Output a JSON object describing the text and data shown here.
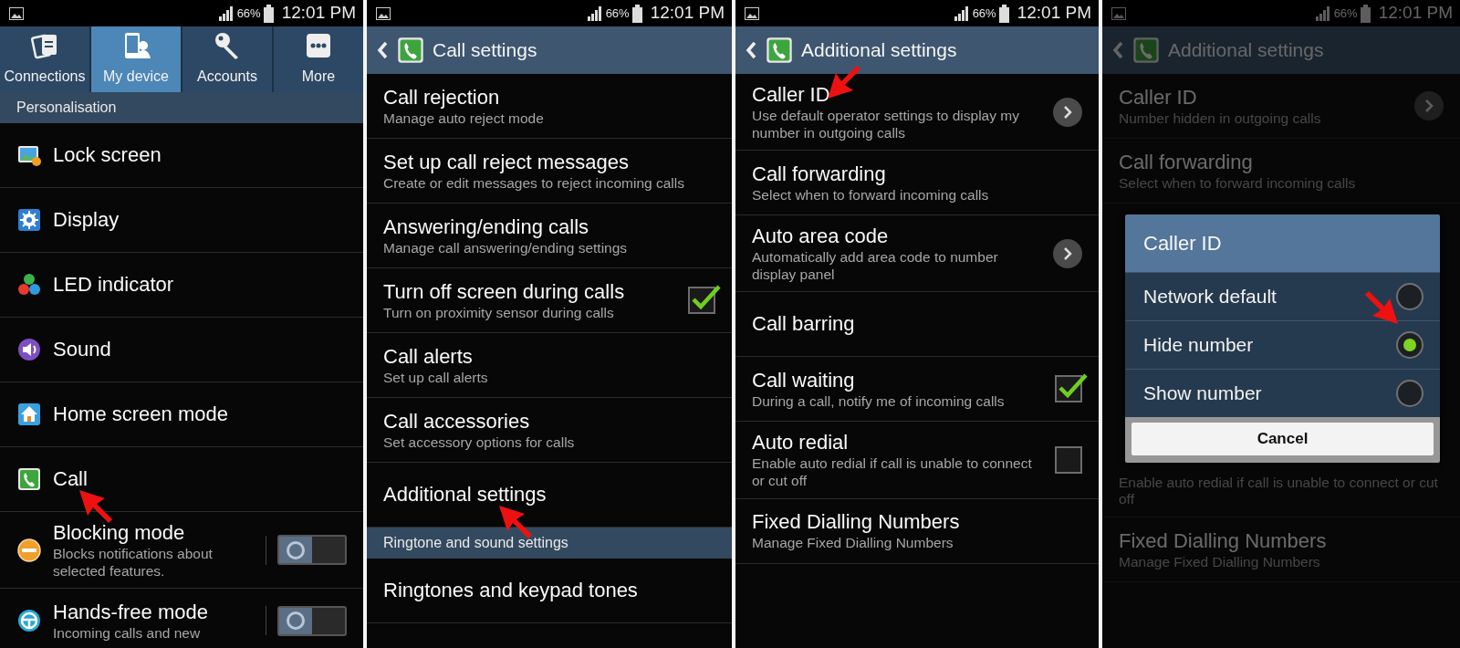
{
  "screens": [
    {
      "dimmed": false,
      "status_bar": {
        "battery": "66%",
        "time": "12:01 PM"
      },
      "tabs": [
        {
          "label": "Connections",
          "selected": false
        },
        {
          "label": "My device",
          "selected": true
        },
        {
          "label": "Accounts",
          "selected": false
        },
        {
          "label": "More",
          "selected": false
        }
      ],
      "list": [
        {
          "kind": "section",
          "title": "Personalisation"
        },
        {
          "kind": "item",
          "title": "Lock screen"
        },
        {
          "kind": "item",
          "title": "Display"
        },
        {
          "kind": "item",
          "title": "LED indicator"
        },
        {
          "kind": "item",
          "title": "Sound"
        },
        {
          "kind": "item",
          "title": "Home screen mode"
        },
        {
          "kind": "item",
          "title": "Call",
          "arrow": {
            "kind": "up-left"
          }
        },
        {
          "kind": "item",
          "title": "Blocking mode",
          "subtitle": "Blocks notifications about selected features.",
          "control": {
            "kind": "toggle",
            "on": false
          }
        },
        {
          "kind": "item",
          "title": "Hands-free mode",
          "subtitle": "Incoming calls and new",
          "control": {
            "kind": "toggle",
            "on": false
          }
        }
      ]
    },
    {
      "dimmed": false,
      "status_bar": {
        "battery": "66%",
        "time": "12:01 PM"
      },
      "app_bar": {
        "title": "Call settings"
      },
      "list": [
        {
          "kind": "item",
          "title": "Call rejection",
          "subtitle": "Manage auto reject mode"
        },
        {
          "kind": "item",
          "title": "Set up call reject messages",
          "subtitle": "Create or edit messages to reject incoming calls"
        },
        {
          "kind": "item",
          "title": "Answering/ending calls",
          "subtitle": "Manage call answering/ending settings"
        },
        {
          "kind": "item",
          "title": "Turn off screen during calls",
          "subtitle": "Turn on proximity sensor during calls",
          "control": {
            "kind": "checkbox",
            "checked": true
          }
        },
        {
          "kind": "item",
          "title": "Call alerts",
          "subtitle": "Set up call alerts"
        },
        {
          "kind": "item",
          "title": "Call accessories",
          "subtitle": "Set accessory options for calls"
        },
        {
          "kind": "item",
          "title": "Additional settings",
          "arrow": {
            "kind": "up-left"
          }
        },
        {
          "kind": "section",
          "title": "Ringtone and sound settings"
        },
        {
          "kind": "item",
          "title": "Ringtones and keypad tones"
        }
      ]
    },
    {
      "dimmed": false,
      "status_bar": {
        "battery": "66%",
        "time": "12:01 PM"
      },
      "app_bar": {
        "title": "Additional settings"
      },
      "list": [
        {
          "kind": "item",
          "title": "Caller ID",
          "subtitle": "Use default operator settings to display my number in outgoing calls",
          "control": {
            "kind": "chevron"
          },
          "arrow": {
            "kind": "down-left"
          }
        },
        {
          "kind": "item",
          "title": "Call forwarding",
          "subtitle": "Select when to forward incoming calls"
        },
        {
          "kind": "item",
          "title": "Auto area code",
          "subtitle": "Automatically add area code to number display panel",
          "control": {
            "kind": "chevron"
          }
        },
        {
          "kind": "item",
          "title": "Call barring"
        },
        {
          "kind": "item",
          "title": "Call waiting",
          "subtitle": "During a call, notify me of incoming calls",
          "control": {
            "kind": "checkbox",
            "checked": true
          }
        },
        {
          "kind": "item",
          "title": "Auto redial",
          "subtitle": "Enable auto redial if call is unable to connect or cut off",
          "control": {
            "kind": "checkbox",
            "checked": false
          }
        },
        {
          "kind": "item",
          "title": "Fixed Dialling Numbers",
          "subtitle": "Manage Fixed Dialling Numbers"
        }
      ]
    },
    {
      "dimmed": true,
      "status_bar": {
        "battery": "66%",
        "time": "12:01 PM"
      },
      "app_bar": {
        "title": "Additional settings"
      },
      "list": [
        {
          "kind": "item",
          "title": "Caller ID",
          "subtitle": "Number hidden in outgoing calls",
          "control": {
            "kind": "chevron"
          }
        },
        {
          "kind": "item",
          "title": "Call forwarding",
          "subtitle": "Select when to forward incoming calls"
        },
        {
          "kind": "dialog",
          "title": "Caller ID",
          "options": [
            {
              "label": "Network default",
              "selected": false
            },
            {
              "label": "Hide number",
              "selected": true,
              "arrow": {
                "kind": "down-right"
              }
            },
            {
              "label": "Show number",
              "selected": false
            }
          ],
          "button": "Cancel"
        },
        {
          "kind": "item",
          "subtitle": "Enable auto redial if call is unable to connect or cut off"
        },
        {
          "kind": "item",
          "title": "Fixed Dialling Numbers",
          "subtitle": "Manage Fixed Dialling Numbers"
        }
      ]
    }
  ]
}
